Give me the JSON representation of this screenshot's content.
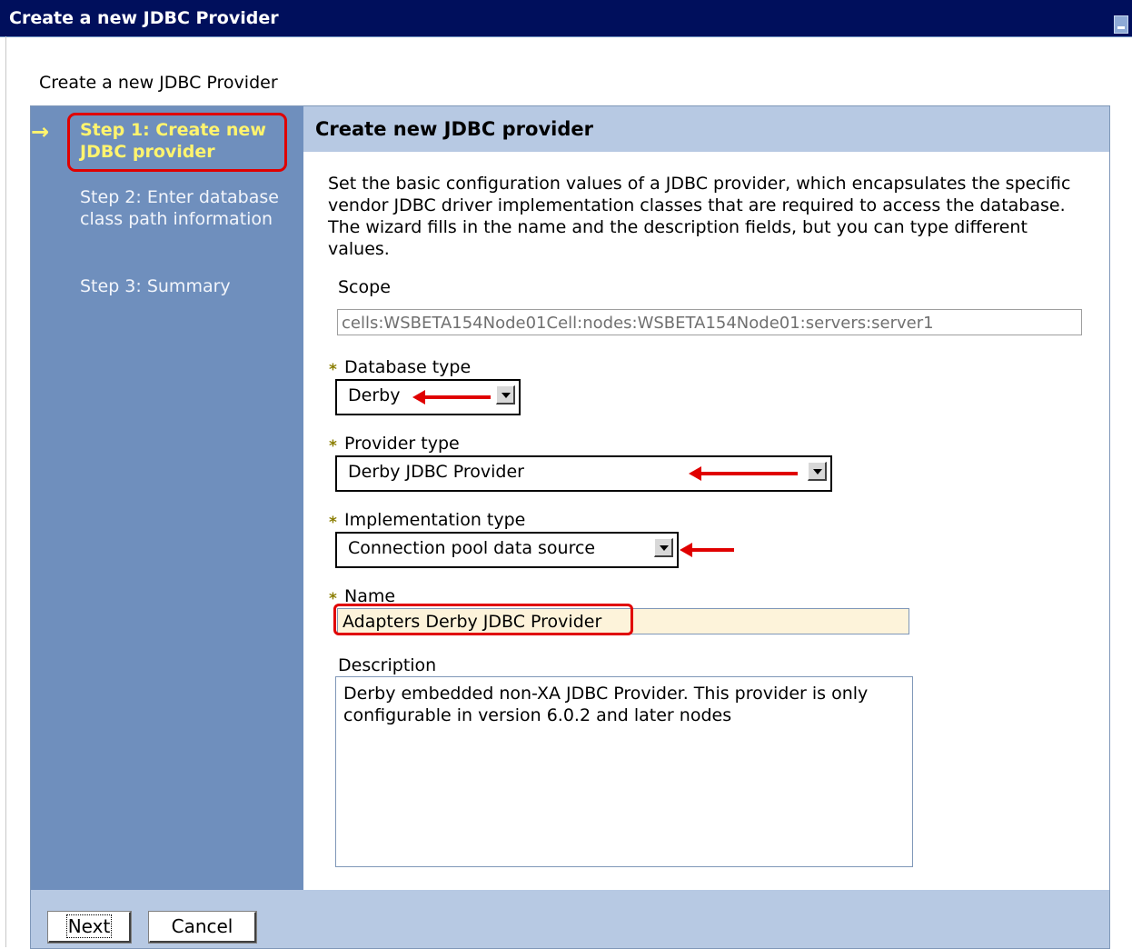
{
  "window": {
    "title": "Create a new JDBC Provider"
  },
  "page": {
    "heading": "Create a new JDBC Provider"
  },
  "steps": [
    {
      "label": "Step 1: Create new JDBC provider",
      "current": true
    },
    {
      "label": "Step 2: Enter database class path information",
      "current": false
    },
    {
      "label": "Step 3: Summary",
      "current": false
    }
  ],
  "panel": {
    "title": "Create new JDBC provider",
    "description": "Set the basic configuration values of a JDBC provider, which encapsulates the specific vendor JDBC driver implementation classes that are required to access the database. The wizard fills in the name and the description fields, but you can type different values."
  },
  "form": {
    "required_marker": "*",
    "scope": {
      "label": "Scope",
      "value": "cells:WSBETA154Node01Cell:nodes:WSBETA154Node01:servers:server1"
    },
    "database_type": {
      "label": "Database type",
      "value": "Derby"
    },
    "provider_type": {
      "label": "Provider type",
      "value": "Derby JDBC Provider"
    },
    "implementation_type": {
      "label": "Implementation type",
      "value": "Connection pool data source"
    },
    "name": {
      "label": "Name",
      "value": "Adapters Derby JDBC Provider"
    },
    "description": {
      "label": "Description",
      "value": "Derby embedded non-XA  JDBC Provider. This provider is only configurable in version 6.0.2 and later nodes"
    }
  },
  "buttons": {
    "next": "Next",
    "cancel": "Cancel"
  },
  "colors": {
    "title_bar": "#000f5c",
    "step_nav": "#6f8fbd",
    "current_step": "#fff46e",
    "panel_header": "#b7c9e3",
    "annotation_red": "#e00000",
    "name_field_bg": "#fdf3da"
  },
  "icons": {
    "current_step": "right-arrow-icon",
    "dropdown": "chevron-down-icon",
    "annotation": "red-arrow-annotation"
  }
}
